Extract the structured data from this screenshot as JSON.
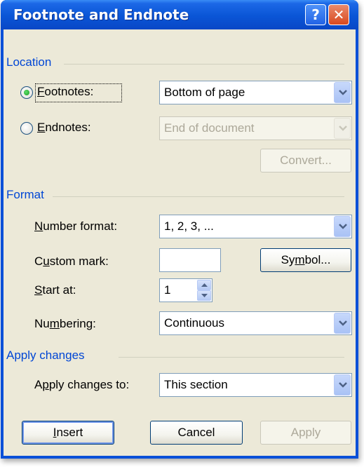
{
  "dialog": {
    "title": "Footnote and Endnote",
    "help_glyph": "?",
    "close_glyph": "✕"
  },
  "location": {
    "group_label": "Location",
    "footnotes": {
      "label_hot": "F",
      "label_rest": "ootnotes:",
      "selected": true,
      "value": "Bottom of page"
    },
    "endnotes": {
      "label_hot": "E",
      "label_rest": "ndnotes:",
      "selected": false,
      "value": "End of document"
    },
    "convert_label": "Convert..."
  },
  "format": {
    "group_label": "Format",
    "number_format": {
      "label_hot": "N",
      "label_rest": "umber format:",
      "value": "1, 2, 3, ..."
    },
    "custom_mark": {
      "label_pre": "C",
      "label_hot": "u",
      "label_rest": "stom mark:",
      "value": ""
    },
    "symbol_label_pre": "Sy",
    "symbol_label_hot": "m",
    "symbol_label_rest": "bol...",
    "start_at": {
      "label_hot": "S",
      "label_rest": "tart at:",
      "value": "1"
    },
    "numbering": {
      "label_pre": "Nu",
      "label_hot": "m",
      "label_rest": "bering:",
      "value": "Continuous"
    }
  },
  "apply_changes": {
    "group_label": "Apply changes",
    "label_pre": "A",
    "label_hot": "p",
    "label_rest": "ply changes to:",
    "value": "This section"
  },
  "buttons": {
    "insert_hot": "I",
    "insert_rest": "nsert",
    "cancel": "Cancel",
    "apply": "Apply"
  }
}
